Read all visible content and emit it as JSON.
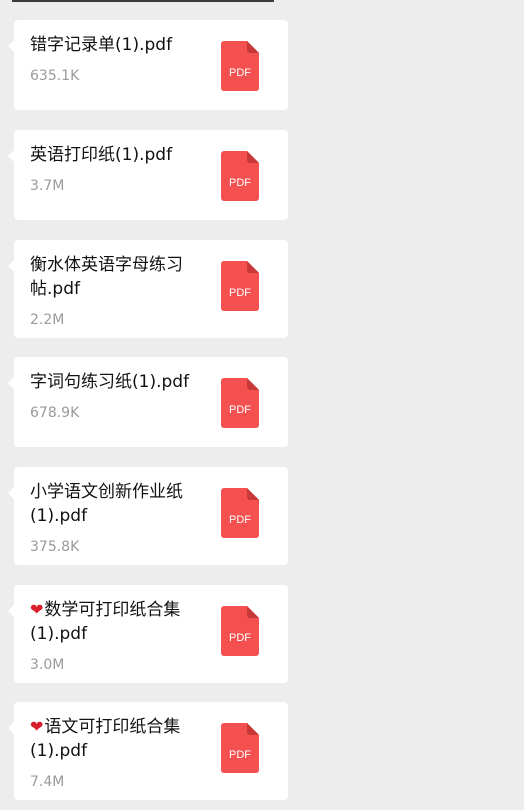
{
  "files": [
    {
      "name": "错字记录单(1).pdf",
      "size": "635.1K",
      "heart": false
    },
    {
      "name": "英语打印纸(1).pdf",
      "size": "3.7M",
      "heart": false
    },
    {
      "name": "衡水体英语字母练习帖.pdf",
      "size": "2.2M",
      "heart": false
    },
    {
      "name": "字词句练习纸(1).pdf",
      "size": "678.9K",
      "heart": false
    },
    {
      "name": "小学语文创新作业纸(1).pdf",
      "size": "375.8K",
      "heart": false
    },
    {
      "name": "数学可打印纸合集(1).pdf",
      "size": "3.0M",
      "heart": true
    },
    {
      "name": "语文可打印纸合集(1).pdf",
      "size": "7.4M",
      "heart": true
    }
  ],
  "icon_label": "PDF",
  "icon_name": "pdf-file-icon",
  "colors": {
    "pdf_red": "#f55050",
    "pdf_fold": "#c93838",
    "heart": "#d81e2c",
    "size_text": "#9a9a9a"
  }
}
